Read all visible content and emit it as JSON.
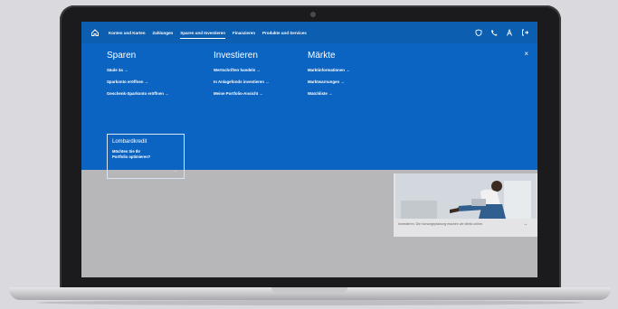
{
  "nav": {
    "items": [
      {
        "label": "Konten und Karten",
        "active": false
      },
      {
        "label": "Zahlungen",
        "active": false
      },
      {
        "label": "Sparen und Investieren",
        "active": true
      },
      {
        "label": "Finanzieren",
        "active": false
      },
      {
        "label": "Produkte und Services",
        "active": false
      }
    ],
    "icons": [
      "shield-icon",
      "phone-icon",
      "user-icon",
      "logout-icon"
    ]
  },
  "menu": {
    "columns": [
      {
        "title": "Sparen",
        "links": [
          "Säule 3a →",
          "Sparkonto eröffnen →",
          "Geschenk-Sparkonto eröffnen →"
        ]
      },
      {
        "title": "Investieren",
        "links": [
          "Wertschriften handeln →",
          "In Anlagefonds investieren →",
          "Meine Portfolio-Ansicht →"
        ]
      },
      {
        "title": "Märkte",
        "links": [
          "Marktinformationen →",
          "Marktwarnungen →",
          "Watchliste →"
        ]
      }
    ],
    "close": "×",
    "promo": {
      "title": "Lombardkredit",
      "text": "Möchten Sie Ihr Portfolio optimieren?",
      "arrow": "→"
    }
  },
  "hero": {
    "caption": "Investieren. Die Vorsorgeplanung machen wir direkt online.",
    "arrow": "→"
  },
  "colors": {
    "brand": "#0b64c2",
    "nav": "#0c5eb1",
    "overlay": "#b7b7b9"
  }
}
